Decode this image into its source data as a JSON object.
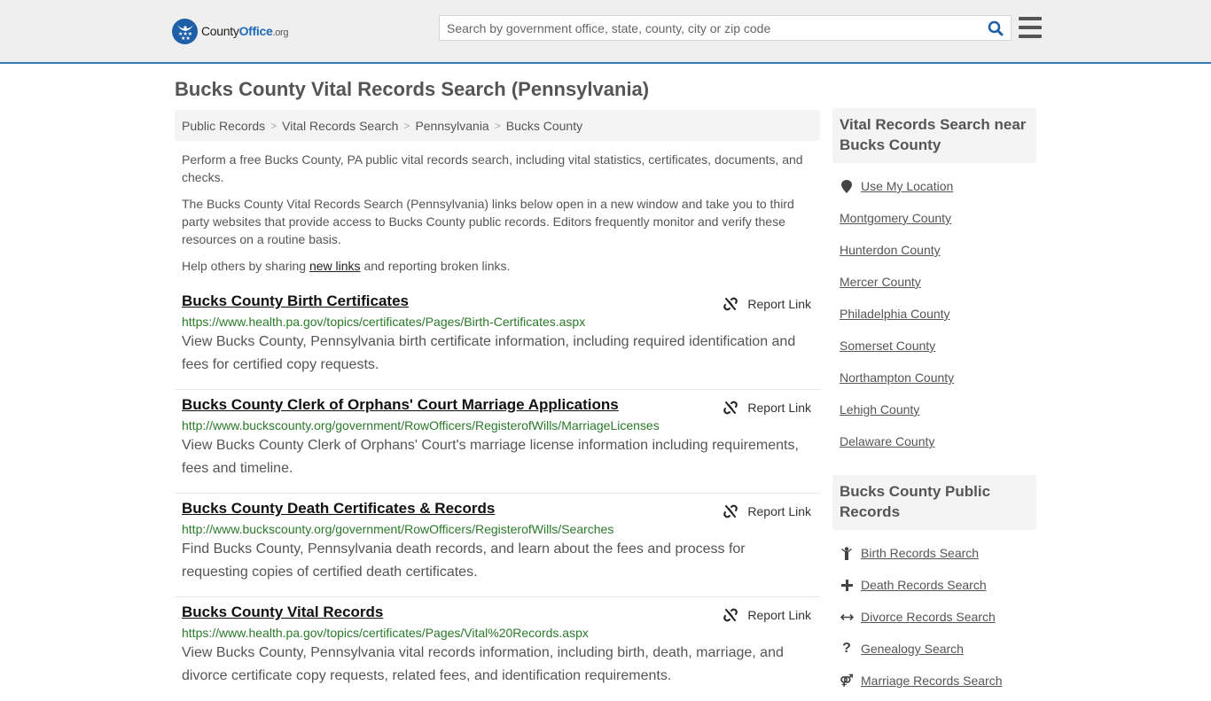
{
  "header": {
    "logo": {
      "county": "County",
      "office": "Office",
      "org": ".org"
    },
    "search": {
      "placeholder": "Search by government office, state, county, city or zip code",
      "value": ""
    }
  },
  "page": {
    "title": "Bucks County Vital Records Search (Pennsylvania)"
  },
  "breadcrumb": [
    {
      "label": "Public Records"
    },
    {
      "label": "Vital Records Search"
    },
    {
      "label": "Pennsylvania"
    },
    {
      "label": "Bucks County"
    }
  ],
  "intro": {
    "p1": "Perform a free Bucks County, PA public vital records search, including vital statistics, certificates, documents, and checks.",
    "p2": "The Bucks County Vital Records Search (Pennsylvania) links below open in a new window and take you to third party websites that provide access to Bucks County public records. Editors frequently monitor and verify these resources on a routine basis.",
    "p3_before": "Help others by sharing ",
    "p3_link": "new links",
    "p3_after": " and reporting broken links."
  },
  "report_label": "Report Link",
  "results": [
    {
      "title": "Bucks County Birth Certificates",
      "url": "https://www.health.pa.gov/topics/certificates/Pages/Birth-Certificates.aspx",
      "description": "View Bucks County, Pennsylvania birth certificate information, including required identification and fees for certified copy requests."
    },
    {
      "title": "Bucks County Clerk of Orphans' Court Marriage Applications",
      "url": "http://www.buckscounty.org/government/RowOfficers/RegisterofWills/MarriageLicenses",
      "description": "View Bucks County Clerk of Orphans' Court's marriage license information including requirements, fees and timeline."
    },
    {
      "title": "Bucks County Death Certificates & Records",
      "url": "http://www.buckscounty.org/government/RowOfficers/RegisterofWills/Searches",
      "description": "Find Bucks County, Pennsylvania death records, and learn about the fees and process for requesting copies of certified death certificates."
    },
    {
      "title": "Bucks County Vital Records",
      "url": "https://www.health.pa.gov/topics/certificates/Pages/Vital%20Records.aspx",
      "description": "View Bucks County, Pennsylvania vital records information, including birth, death, marriage, and divorce certificate copy requests, related fees, and identification requirements."
    }
  ],
  "sidebar": {
    "nearby": {
      "heading": "Vital Records Search near Bucks County",
      "use_location": "Use My Location",
      "counties": [
        "Montgomery County",
        "Hunterdon County",
        "Mercer County",
        "Philadelphia County",
        "Somerset County",
        "Northampton County",
        "Lehigh County",
        "Delaware County"
      ]
    },
    "public_records": {
      "heading": "Bucks County Public Records",
      "items": [
        {
          "label": "Birth Records Search",
          "icon": "child-icon"
        },
        {
          "label": "Death Records Search",
          "icon": "cross-icon"
        },
        {
          "label": "Divorce Records Search",
          "icon": "arrows-h-icon"
        },
        {
          "label": "Genealogy Search",
          "icon": "question-icon"
        },
        {
          "label": "Marriage Records Search",
          "icon": "venus-mars-icon"
        }
      ]
    }
  },
  "colors": {
    "brand_blue": "#1f5fa8",
    "header_border": "#3a7cb0",
    "url_green": "#2a7a2a"
  }
}
